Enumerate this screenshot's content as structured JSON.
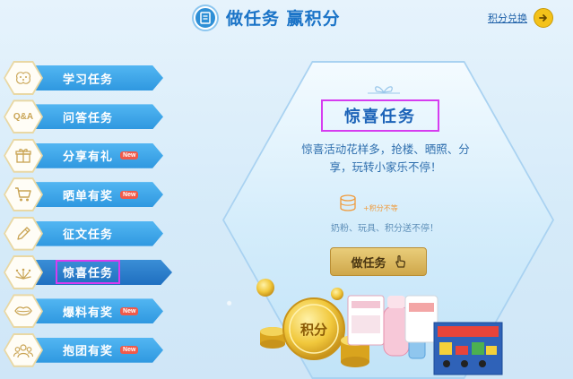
{
  "header": {
    "title": "做任务 赢积分",
    "exchange_label": "积分兑换"
  },
  "sidebar": {
    "items": [
      {
        "label": "学习任务",
        "icon": "brain-icon",
        "badge": ""
      },
      {
        "label": "问答任务",
        "icon": "qa-icon",
        "badge": ""
      },
      {
        "label": "分享有礼",
        "icon": "gift-icon",
        "badge": "New"
      },
      {
        "label": "晒单有奖",
        "icon": "cart-icon",
        "badge": "New"
      },
      {
        "label": "征文任务",
        "icon": "pencil-icon",
        "badge": ""
      },
      {
        "label": "惊喜任务",
        "icon": "sparkle-icon",
        "badge": ""
      },
      {
        "label": "爆料有奖",
        "icon": "lips-icon",
        "badge": "New"
      },
      {
        "label": "抱团有奖",
        "icon": "group-icon",
        "badge": "New"
      }
    ],
    "active": "惊喜任务"
  },
  "panel": {
    "title": "惊喜任务",
    "description": "惊喜活动花样多，抢楼、晒照、分享，玩转小家乐不停！",
    "reward_note": "+积分不等",
    "reward_text": "奶粉、玩具、积分送不停！",
    "button_label": "做任务",
    "coin_label": "积分"
  },
  "colors": {
    "primary_blue": "#2f98e0",
    "active_blue": "#1f6fc0",
    "highlight_magenta": "#d63cf0",
    "gold": "#cfa74a",
    "badge_red": "#f05a4a"
  }
}
